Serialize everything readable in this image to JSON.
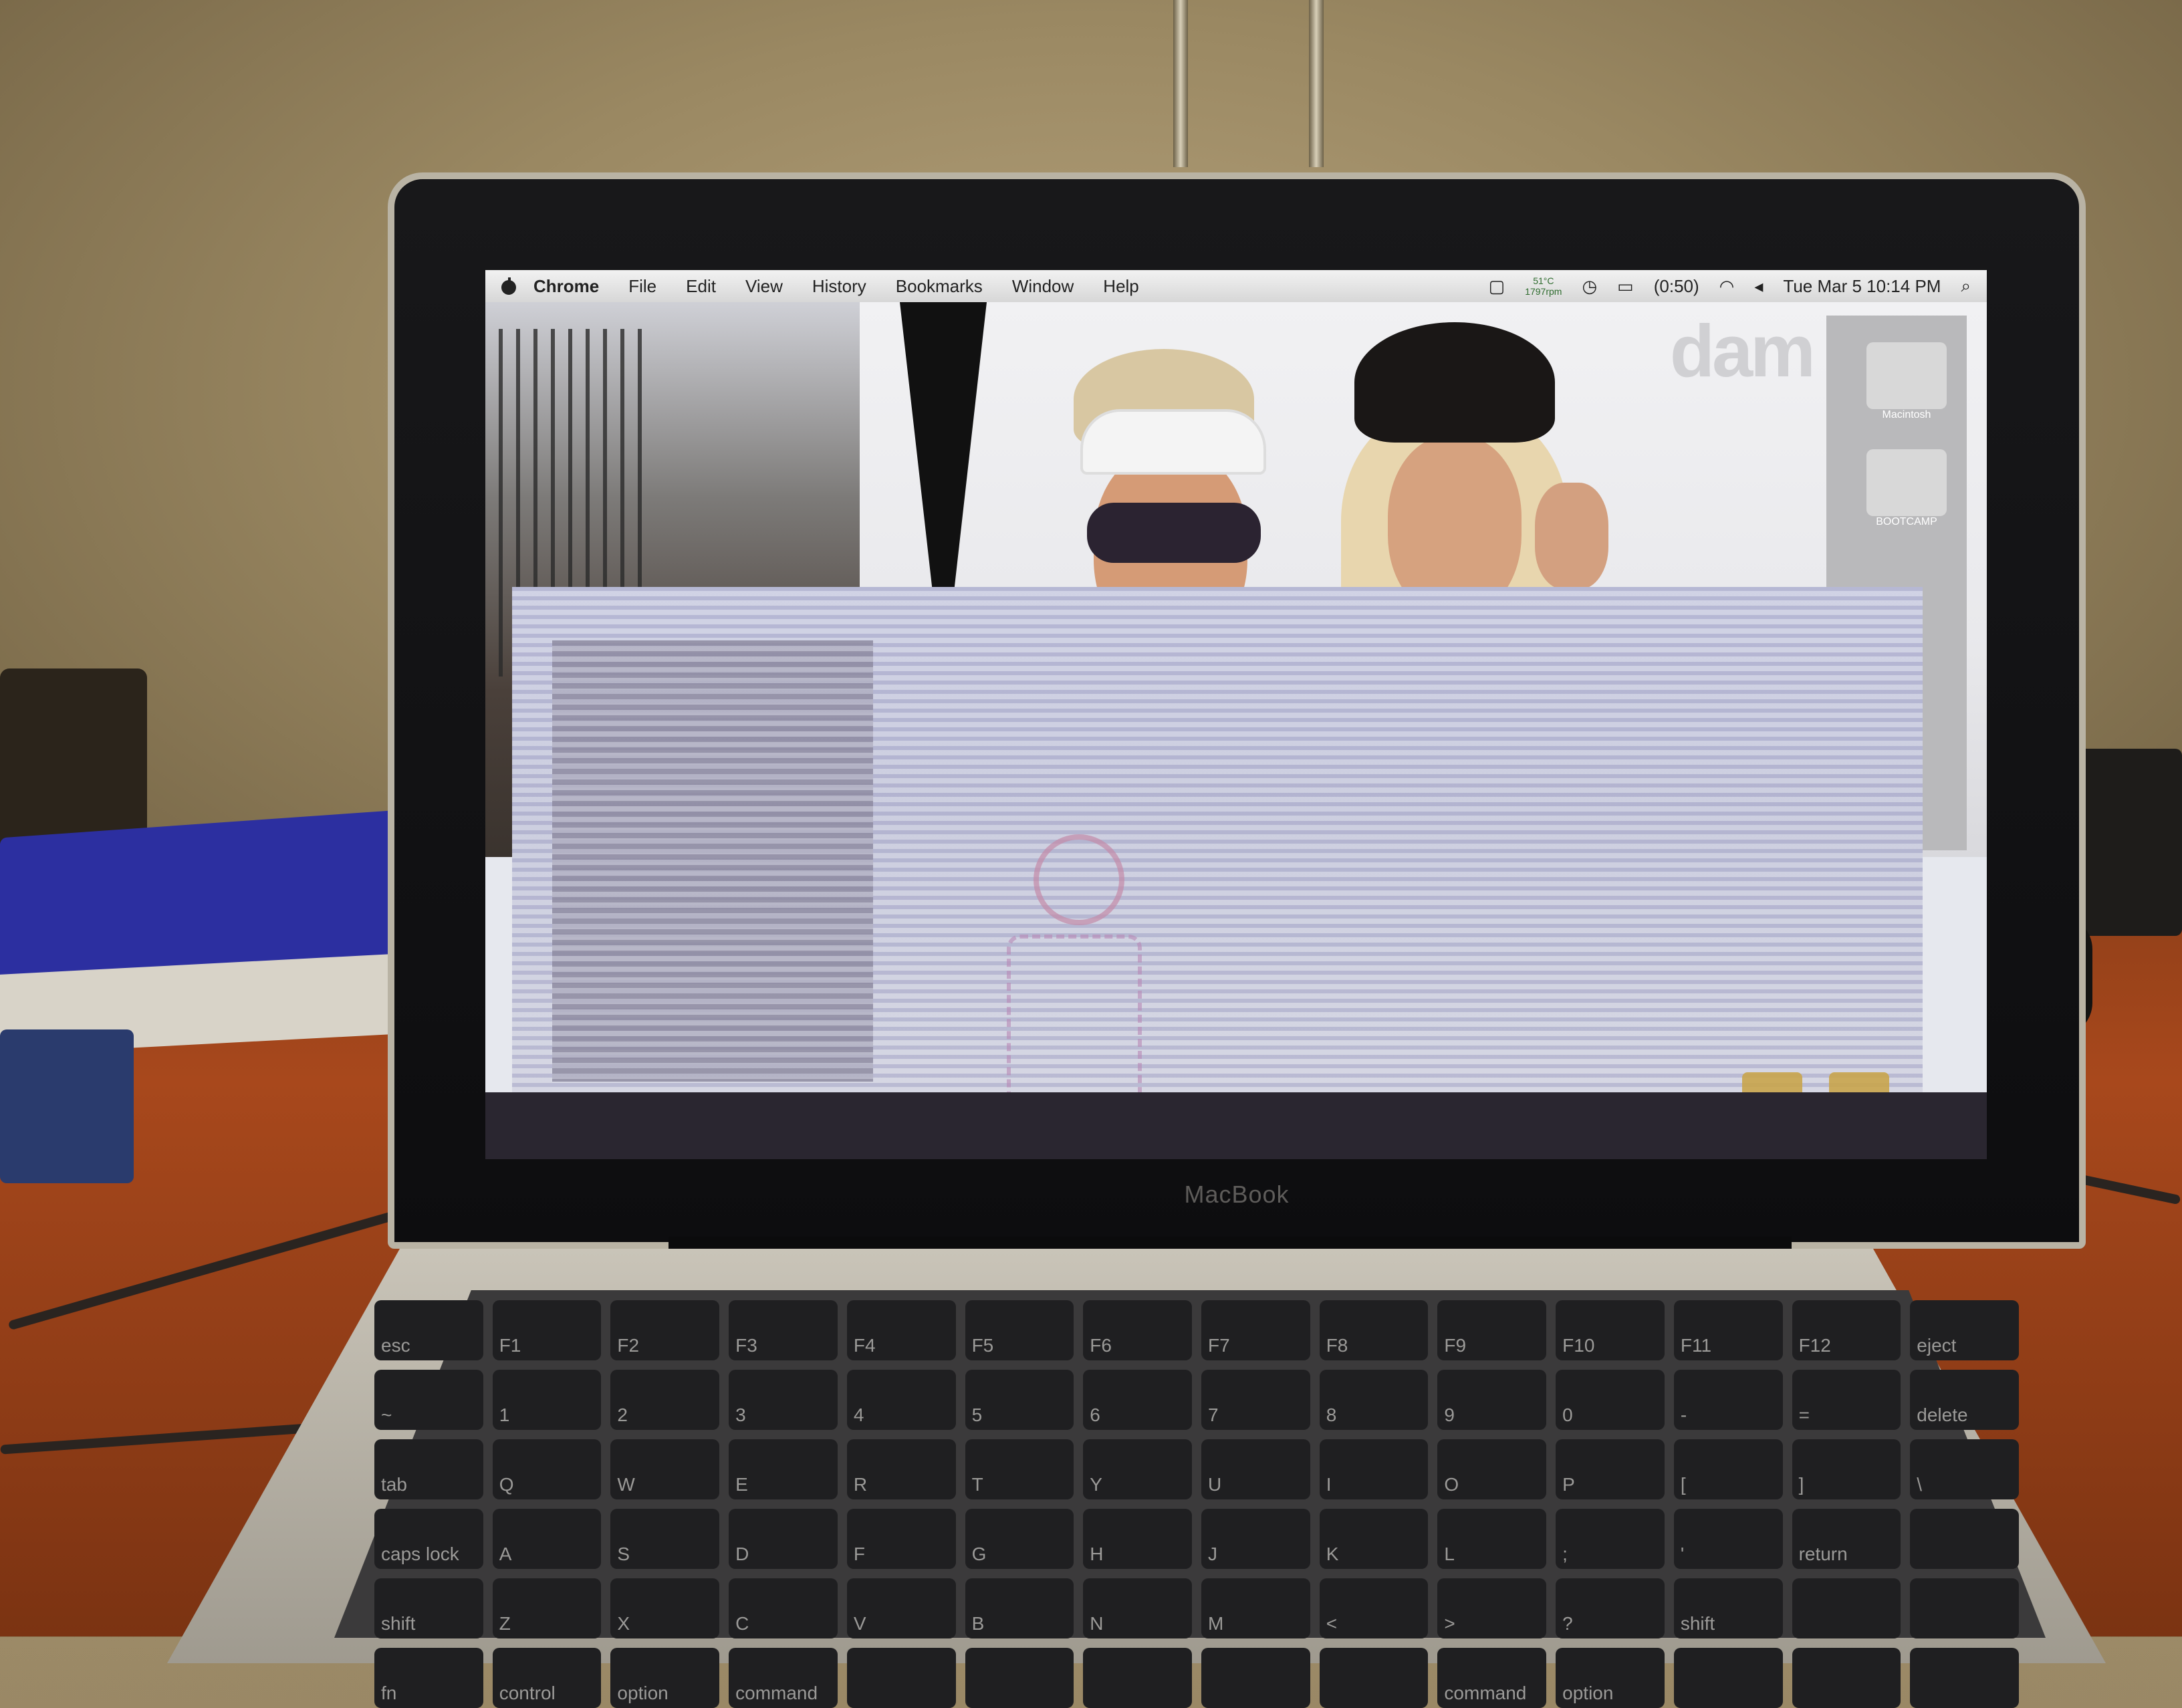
{
  "menubar": {
    "app_name": "Chrome",
    "menus": [
      "File",
      "Edit",
      "View",
      "History",
      "Bookmarks",
      "Window",
      "Help"
    ],
    "temperature": "51°C",
    "fan": "1797rpm",
    "battery": "(0:50)",
    "clock": "Tue Mar 5  10:14 PM"
  },
  "desktop": {
    "watermark": "dam",
    "drives": [
      "Macintosh",
      "BOOTCAMP"
    ]
  },
  "laptop": {
    "brand": "MacBook"
  },
  "keyboard": {
    "keys": [
      "esc",
      "F1",
      "F2",
      "F3",
      "F4",
      "F5",
      "F6",
      "F7",
      "F8",
      "F9",
      "F10",
      "F11",
      "F12",
      "eject",
      "~",
      "1",
      "2",
      "3",
      "4",
      "5",
      "6",
      "7",
      "8",
      "9",
      "0",
      "-",
      "=",
      "delete",
      "tab",
      "Q",
      "W",
      "E",
      "R",
      "T",
      "Y",
      "U",
      "I",
      "O",
      "P",
      "[",
      "]",
      "\\",
      "caps lock",
      "A",
      "S",
      "D",
      "F",
      "G",
      "H",
      "J",
      "K",
      "L",
      ";",
      "'",
      "return",
      "",
      "shift",
      "Z",
      "X",
      "C",
      "V",
      "B",
      "N",
      "M",
      "<",
      ">",
      "?",
      "shift",
      "",
      "",
      "fn",
      "control",
      "option",
      "command",
      "",
      "",
      "",
      "",
      "",
      "command",
      "option",
      "",
      "",
      ""
    ]
  }
}
